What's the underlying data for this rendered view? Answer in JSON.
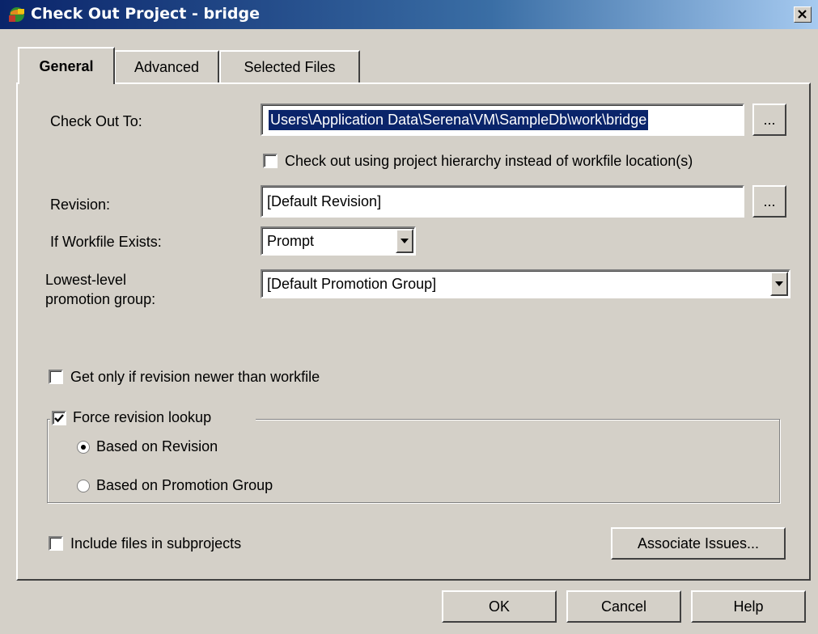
{
  "window": {
    "title": "Check Out Project - bridge",
    "close_glyph": "×",
    "icon": "app-icon"
  },
  "tabs": [
    {
      "label": "General",
      "active": true
    },
    {
      "label": "Advanced",
      "active": false
    },
    {
      "label": "Selected Files",
      "active": false
    }
  ],
  "form": {
    "check_out_to": {
      "label": "Check Out To:",
      "value": "Users\\Application Data\\Serena\\VM\\SampleDb\\work\\bridge",
      "browse_label": "..."
    },
    "hierarchy_checkbox": {
      "label": "Check out using project hierarchy instead of workfile location(s)",
      "checked": false
    },
    "revision": {
      "label": "Revision:",
      "value": "[Default Revision]",
      "browse_label": "..."
    },
    "if_workfile_exists": {
      "label": "If Workfile Exists:",
      "value": "Prompt"
    },
    "promotion_group": {
      "label_line1": "Lowest-level",
      "label_line2": "promotion group:",
      "value": "[Default Promotion Group]"
    },
    "get_only_newer": {
      "label": "Get only if revision newer than workfile",
      "checked": false
    },
    "force_lookup": {
      "label": "Force revision lookup",
      "checked": true,
      "options": [
        {
          "label": "Based on Revision",
          "selected": true
        },
        {
          "label": "Based on Promotion Group",
          "selected": false
        }
      ]
    },
    "include_subprojects": {
      "label": "Include files in subprojects",
      "checked": false
    },
    "associate_issues_label": "Associate Issues..."
  },
  "footer": {
    "ok_label": "OK",
    "cancel_label": "Cancel",
    "help_label": "Help"
  },
  "colors": {
    "face": "#d4d0c8",
    "title_start": "#0a246a",
    "title_end": "#a6caf0",
    "selection": "#0a246a"
  }
}
